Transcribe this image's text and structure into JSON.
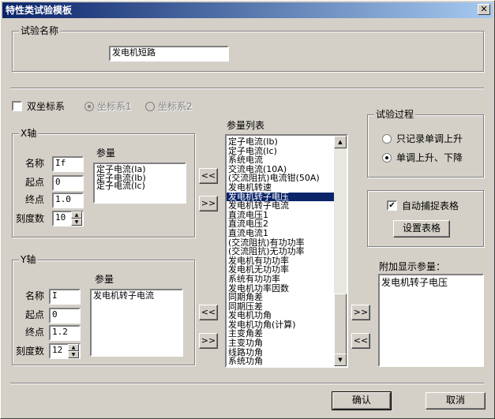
{
  "window": {
    "title": "特性类试验模板",
    "close_glyph": "✕"
  },
  "test_name": {
    "group_label": "试验名称",
    "value": "发电机短路"
  },
  "dual_axis": {
    "label": "双坐标系",
    "checked": false,
    "radio1": "坐标系1",
    "radio2": "坐标系2"
  },
  "x_axis": {
    "group_label": "X轴",
    "name_label": "名称",
    "name_value": "If",
    "start_label": "起点",
    "start_value": "0",
    "end_label": "终点",
    "end_value": "1.0",
    "ticks_label": "刻度数",
    "ticks_value": "10",
    "params_label": "参量",
    "params": [
      "定子电流(Ia)",
      "定子电流(Ib)",
      "定子电流(Ic)"
    ]
  },
  "y_axis": {
    "group_label": "Y轴",
    "name_label": "名称",
    "name_value": "I",
    "start_label": "起点",
    "start_value": "0",
    "end_label": "终点",
    "end_value": "1.2",
    "ticks_label": "刻度数",
    "ticks_value": "12",
    "params_label": "参量",
    "params": [
      "发电机转子电流"
    ]
  },
  "param_list": {
    "label": "参量列表",
    "items": [
      "定子电流(Ib)",
      "定子电流(Ic)",
      "系统电流",
      "交流电流(10A)",
      "(交流阻抗)电流钳(50A)",
      "发电机转速",
      "发电机转子电压",
      "发电机转子电流",
      "直流电压1",
      "直流电压2",
      "直流电流1",
      "(交流阻抗)有功功率",
      "(交流阻抗)无功功率",
      "发电机有功功率",
      "发电机无功功率",
      "系统有功功率",
      "发电机功率因数",
      "同期角差",
      "同期压差",
      "发电机功角",
      "发电机功角(计算)",
      "主变角差",
      "主变功角",
      "线路功角",
      "系统功角"
    ],
    "selected": "发电机转子电压"
  },
  "process": {
    "group_label": "试验过程",
    "opt1": "只记录单调上升",
    "opt2": "单调上升、下降",
    "selected": 2
  },
  "capture": {
    "auto_label": "自动捕捉表格",
    "auto_checked": true,
    "setup_button": "设置表格"
  },
  "extra": {
    "label": "附加显示参量：",
    "params": [
      "发电机转子电压"
    ]
  },
  "arrows": {
    "left": "<<",
    "right": ">>"
  },
  "buttons": {
    "ok": "确认",
    "cancel": "取消"
  }
}
